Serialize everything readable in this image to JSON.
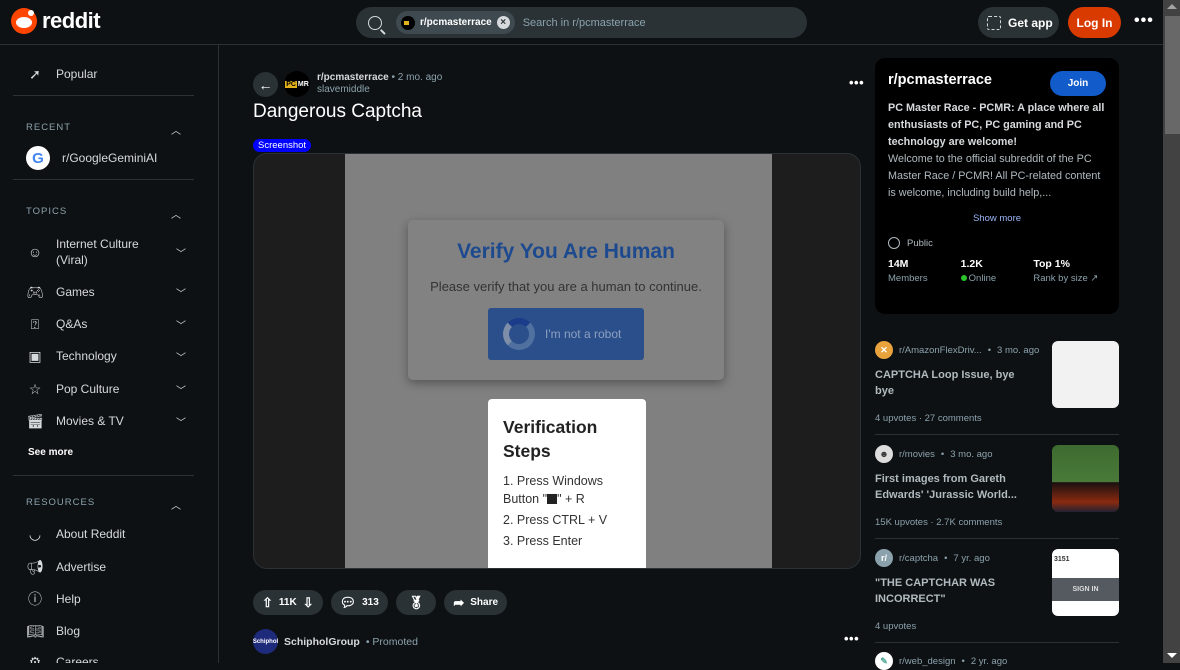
{
  "header": {
    "logo_text": "reddit",
    "search_chip": "r/pcmasterrace",
    "search_placeholder": "Search in r/pcmasterrace",
    "get_app": "Get app",
    "login": "Log In",
    "more": "•••"
  },
  "sidebar": {
    "popular": "Popular",
    "recent_heading": "RECENT",
    "recent_items": [
      {
        "label": "r/GoogleGeminiAI"
      }
    ],
    "topics_heading": "TOPICS",
    "topics": [
      {
        "label_line1": "Internet Culture",
        "label_line2": "(Viral)"
      },
      {
        "label": "Games"
      },
      {
        "label": "Q&As"
      },
      {
        "label": "Technology"
      },
      {
        "label": "Pop Culture"
      },
      {
        "label": "Movies & TV"
      }
    ],
    "see_more": "See more",
    "resources_heading": "RESOURCES",
    "resources": [
      {
        "label": "About Reddit"
      },
      {
        "label": "Advertise"
      },
      {
        "label": "Help"
      },
      {
        "label": "Blog"
      },
      {
        "label": "Careers"
      }
    ]
  },
  "post": {
    "subreddit": "r/pcmasterrace",
    "time": "2 mo. ago",
    "author": "slavemiddle",
    "title": "Dangerous Captcha",
    "flair": "Screenshot",
    "image": {
      "verify_title": "Verify You Are Human",
      "verify_text": "Please verify that you are a human to continue.",
      "robot_button": "I'm not a robot",
      "steps_title_1": "Verification",
      "steps_title_2": "Steps",
      "step1_a": "1. Press Windows",
      "step1_b_pre": "Button \"",
      "step1_b_post": "\" + R",
      "step2": "2. Press CTRL + V",
      "step3": "3. Press Enter"
    },
    "votes": "11K",
    "comments": "313",
    "share": "Share"
  },
  "promoted": {
    "name": "SchipholGroup",
    "tag": "Promoted",
    "avatar_text": "Schiphol"
  },
  "about": {
    "name": "r/pcmasterrace",
    "join": "Join",
    "tagline": "PC Master Race - PCMR: A place where all enthusiasts of PC, PC gaming and PC technology are welcome!",
    "description": "Welcome to the official subreddit of the PC Master Race / PCMR! All PC-related content is welcome, including build help,...",
    "show_more": "Show more",
    "visibility": "Public",
    "stats": [
      {
        "value": "14M",
        "label": "Members"
      },
      {
        "value": "1.2K",
        "label": "Online"
      },
      {
        "value": "Top 1%",
        "label": "Rank by size"
      }
    ]
  },
  "related": [
    {
      "subreddit": "r/AmazonFlexDriv...",
      "time": "3 mo. ago",
      "title": "CAPTCHA Loop Issue, bye bye",
      "stats": "4 upvotes · 27 comments"
    },
    {
      "subreddit": "r/movies",
      "time": "3 mo. ago",
      "title": "First images from Gareth Edwards' 'Jurassic World...",
      "stats": "15K upvotes · 2.7K comments"
    },
    {
      "subreddit": "r/captcha",
      "time": "7 yr. ago",
      "title": "\"THE CAPTCHAR WAS INCORRECT\"",
      "stats": "4 upvotes",
      "thumb_text_1": "3151",
      "thumb_text_2": "SIGN IN"
    },
    {
      "subreddit": "r/web_design",
      "time": "2 yr. ago"
    }
  ]
}
